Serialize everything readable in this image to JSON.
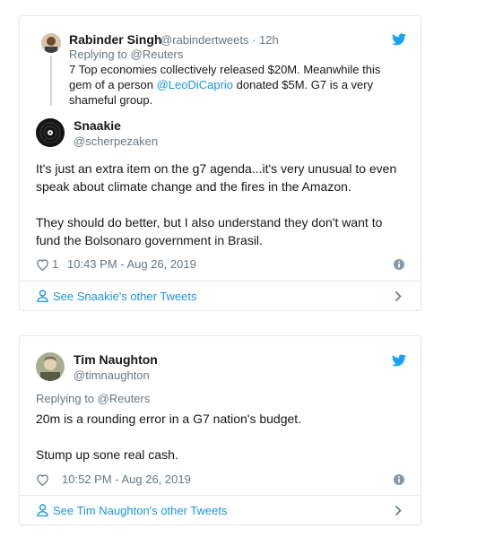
{
  "colors": {
    "link": "#1b95e0",
    "muted": "#657786",
    "border": "#e1e8ed",
    "text": "#14171a"
  },
  "tweet1": {
    "quoted": {
      "name": "Rabinder Singh",
      "handle": "@rabindertweets",
      "sep": "·",
      "time": "12h",
      "replying_to": "Replying to @Reuters",
      "text_line1": "7 Top economies collectively released $20M. Meanwhile this",
      "text_line2_prefix": "gem of a person ",
      "text_line2_mention": "@LeoDiCaprio",
      "text_line2_suffix": " donated $5M. G7 is a very",
      "text_line3": "shameful group."
    },
    "name": "Snaakie",
    "handle": "@scherpezaken",
    "text_p1_line1": "It's just an extra item on the g7 agenda...it's very unusual to even",
    "text_p1_line2": "speak about climate change and the fires in the Amazon.",
    "text_p2_line1": "They should do better, but I also understand they don't want to",
    "text_p2_line2": "fund the Bolsonaro government in Brasil.",
    "likes": "1",
    "timestamp": "10:43 PM - Aug 26, 2019",
    "footer_link": "See Snaakie's other Tweets",
    "icons": {
      "like": "heart-icon",
      "info": "info-icon",
      "brand": "twitter-bird-icon",
      "chevron": "chevron-right-icon",
      "person": "person-icon"
    }
  },
  "tweet2": {
    "name": "Tim Naughton",
    "handle": "@timnaughton",
    "replying_to": "Replying to @Reuters",
    "text_line1": "20m is a rounding error in a G7 nation's budget.",
    "text_line2": "Stump up sone real cash.",
    "timestamp": "10:52 PM - Aug 26, 2019",
    "footer_link": "See Tim Naughton's other Tweets"
  }
}
